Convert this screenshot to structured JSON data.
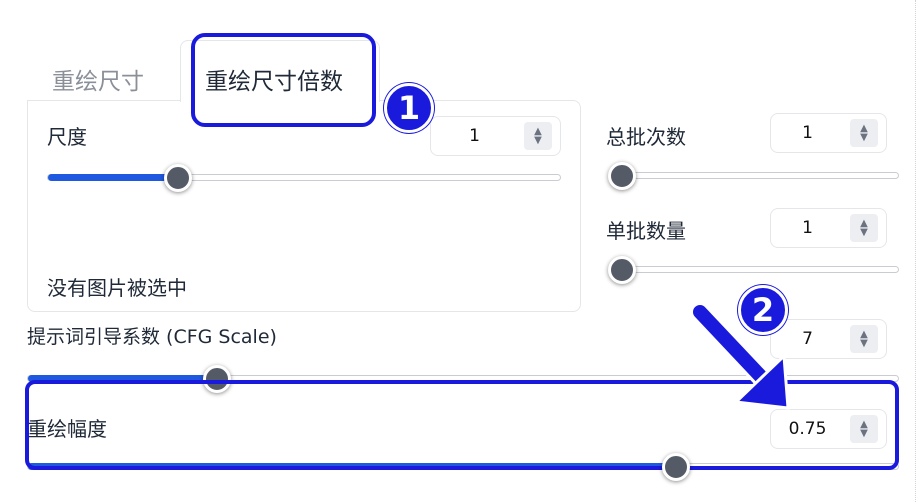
{
  "tabs": [
    {
      "label": "重绘尺寸"
    },
    {
      "label": "重绘尺寸倍数"
    }
  ],
  "scale": {
    "label": "尺度",
    "value": "1",
    "slider_fraction": 0.3
  },
  "no_image_text": "没有图片被选中",
  "batch_count": {
    "label": "总批次数",
    "value": "1",
    "slider_fraction": 0.0
  },
  "batch_size": {
    "label": "单批数量",
    "value": "1",
    "slider_fraction": 0.0
  },
  "cfg_scale": {
    "label": "提示词引导系数 (CFG Scale)",
    "value": "7"
  },
  "denoising": {
    "label": "重绘幅度",
    "value": "0.75"
  },
  "badges": {
    "one": "1",
    "two": "2"
  },
  "colors": {
    "accent": "#1a1adc",
    "slider_fill": "#1f59e0",
    "thumb": "#555b66"
  },
  "icons": {
    "spinner_up": "▲",
    "spinner_down": "▼"
  }
}
